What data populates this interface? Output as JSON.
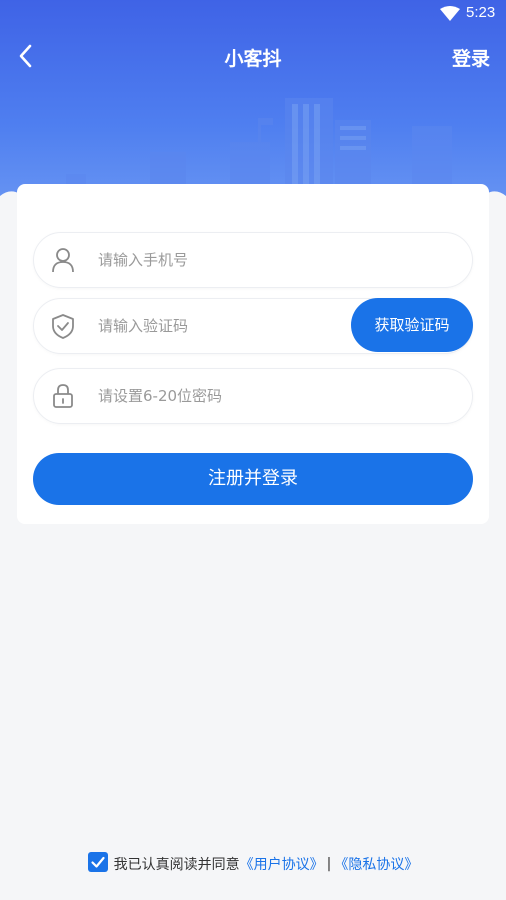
{
  "status_bar": {
    "time": "5:23"
  },
  "nav": {
    "title": "小客抖",
    "action_label": "登录"
  },
  "form": {
    "phone": {
      "placeholder": "请输入手机号",
      "value": ""
    },
    "code": {
      "placeholder": "请输入验证码",
      "value": "",
      "button_label": "获取验证码"
    },
    "password": {
      "placeholder": "请设置6-20位密码",
      "value": ""
    },
    "submit_label": "注册并登录"
  },
  "agreement": {
    "checked": true,
    "text": "我已认真阅读并同意",
    "user_agreement": "《用户协议》",
    "separator": "|",
    "privacy_agreement": "《隐私协议》"
  },
  "colors": {
    "accent": "#1a73e8",
    "banner_top": "#3f63e6",
    "banner_bottom": "#6f9bf3",
    "background": "#f5f6f8"
  },
  "icons": {
    "back": "back-arrow-icon",
    "wifi": "wifi-icon",
    "phone_field": "user-icon",
    "code_field": "shield-check-icon",
    "password_field": "lock-icon",
    "checkbox": "checkbox-checked-icon"
  }
}
